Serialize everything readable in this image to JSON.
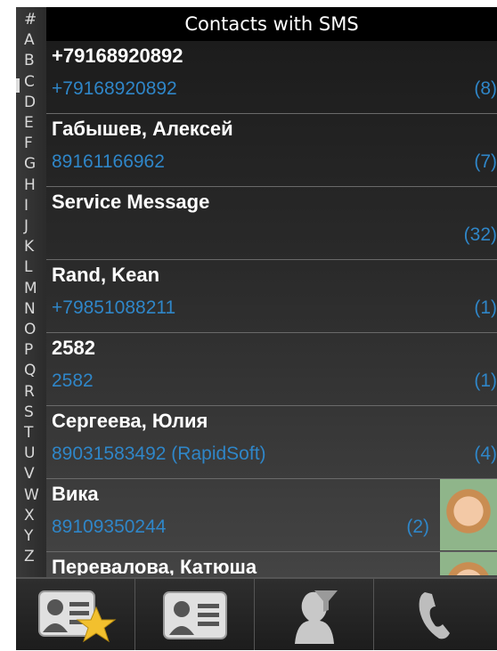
{
  "header": {
    "title": "Contacts with SMS"
  },
  "alphabet": [
    "#",
    "A",
    "B",
    "C",
    "D",
    "E",
    "F",
    "G",
    "H",
    "I",
    "J",
    "K",
    "L",
    "M",
    "N",
    "O",
    "P",
    "Q",
    "R",
    "S",
    "T",
    "U",
    "V",
    "W",
    "X",
    "Y",
    "Z"
  ],
  "contacts": [
    {
      "name": "+79168920892",
      "number": "+79168920892",
      "count": "(8)",
      "photo": false
    },
    {
      "name": "Габышев, Алексей",
      "number": "89161166962",
      "count": "(7)",
      "photo": false
    },
    {
      "name": "Service Message",
      "number": "",
      "count": "(32)",
      "photo": false
    },
    {
      "name": "Rand, Kean",
      "number": "+79851088211",
      "count": "(1)",
      "photo": false
    },
    {
      "name": "2582",
      "number": "2582",
      "count": "(1)",
      "photo": false
    },
    {
      "name": "Сергеева, Юлия",
      "number": "89031583492 (RapidSoft)",
      "count": "(4)",
      "photo": false
    },
    {
      "name": "Вика",
      "number": "89109350244",
      "count": "(2)",
      "photo": true
    },
    {
      "name": "Перевалова, Катюша",
      "number": "",
      "count": "",
      "photo": true
    }
  ],
  "toolbar": {
    "items": [
      {
        "icon": "favorite-contacts-icon"
      },
      {
        "icon": "contact-card-icon"
      },
      {
        "icon": "contact-filter-icon"
      },
      {
        "icon": "phone-icon"
      }
    ]
  },
  "colors": {
    "accent": "#2f86c8",
    "header_bg": "#000000"
  }
}
